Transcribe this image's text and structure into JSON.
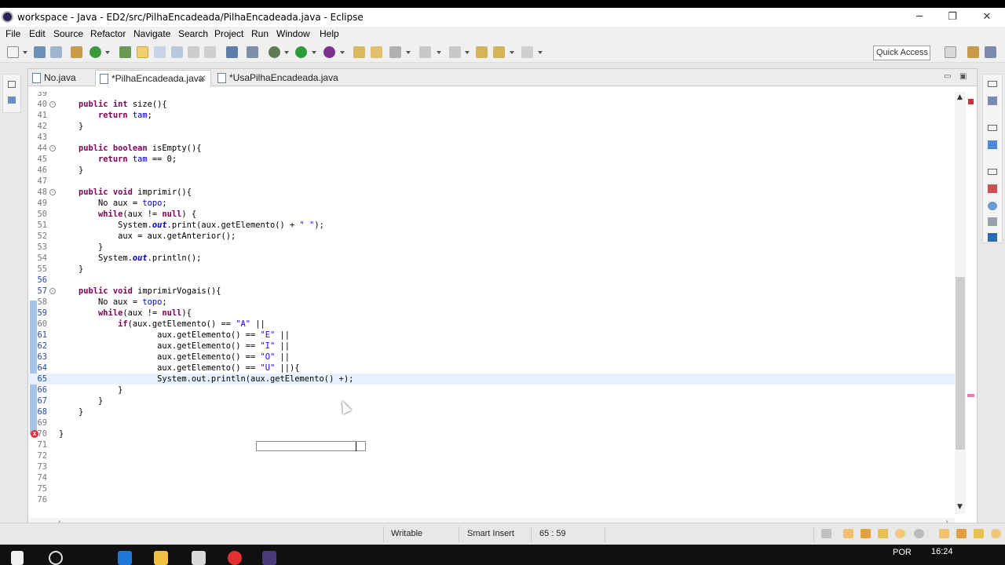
{
  "window": {
    "title": "workspace - Java - ED2/src/PilhaEncadeada/PilhaEncadeada.java - Eclipse",
    "minimize": "─",
    "restore": "❐",
    "close": "✕"
  },
  "menu": [
    "File",
    "Edit",
    "Source",
    "Refactor",
    "Navigate",
    "Search",
    "Project",
    "Run",
    "Window",
    "Help"
  ],
  "toolbar": {
    "quick_access": "Quick Access"
  },
  "tabs": [
    {
      "label": "No.java",
      "active": false
    },
    {
      "label": "*PilhaEncadeada.java",
      "active": true,
      "close": "✕"
    },
    {
      "label": "*UsaPilhaEncadeada.java",
      "active": false
    }
  ],
  "editor": {
    "lines": [
      {
        "n": "39",
        "html": ""
      },
      {
        "n": "40",
        "fold": "⊖",
        "html": "    <span class=\"kw\">public</span> <span class=\"kw\">int</span> size(){"
      },
      {
        "n": "41",
        "html": "        <span class=\"kw\">return</span> <span class=\"fld\">tam</span>;"
      },
      {
        "n": "42",
        "html": "    }"
      },
      {
        "n": "43",
        "html": ""
      },
      {
        "n": "44",
        "fold": "⊖",
        "html": "    <span class=\"kw\">public</span> <span class=\"kw\">boolean</span> isEmpty(){"
      },
      {
        "n": "45",
        "html": "        <span class=\"kw\">return</span> <span class=\"fld\">tam</span> == 0;"
      },
      {
        "n": "46",
        "html": "    }"
      },
      {
        "n": "47",
        "html": ""
      },
      {
        "n": "48",
        "fold": "⊖",
        "html": "    <span class=\"kw\">public</span> <span class=\"kw\">void</span> imprimir(){"
      },
      {
        "n": "49",
        "html": "        No aux = <span class=\"fld\">topo</span>;"
      },
      {
        "n": "50",
        "html": "        <span class=\"kw\">while</span>(aux != <span class=\"kw\">null</span>) {"
      },
      {
        "n": "51",
        "html": "            System.<span class=\"sf\">out</span>.print(aux.getElemento() + <span class=\"str\">\" \"</span>);"
      },
      {
        "n": "52",
        "html": "            aux = aux.getAnterior();"
      },
      {
        "n": "53",
        "html": "        }"
      },
      {
        "n": "54",
        "html": "        System.<span class=\"sf\">out</span>.println();"
      },
      {
        "n": "55",
        "html": "    }"
      },
      {
        "n": "56",
        "changed": true,
        "html": ""
      },
      {
        "n": "57",
        "changed": true,
        "fold": "⊖",
        "html": "    <span class=\"kw\">public</span> <span class=\"kw\">void</span> imprimirVogais(){"
      },
      {
        "n": "58",
        "html": "        No aux = <span class=\"fld\">topo</span>;"
      },
      {
        "n": "59",
        "changed": true,
        "html": "        <span class=\"kw\">while</span>(aux != <span class=\"kw\">null</span>){"
      },
      {
        "n": "60",
        "html": "            <span class=\"kw\">if</span>(aux.getElemento() == <span class=\"str\">\"A\"</span> ||"
      },
      {
        "n": "61",
        "changed": true,
        "html": "                    aux.getElemento() == <span class=\"str\">\"E\"</span> ||"
      },
      {
        "n": "62",
        "changed": true,
        "html": "                    aux.getElemento() == <span class=\"str\">\"I\"</span> ||"
      },
      {
        "n": "63",
        "changed": true,
        "html": "                    aux.getElemento() == <span class=\"str\">\"O\"</span> ||"
      },
      {
        "n": "64",
        "changed": true,
        "error": true,
        "html": "                    aux.getElemento() == <span class=\"str\">\"U\"</span> ||){"
      },
      {
        "n": "65",
        "changed": true,
        "current": true,
        "html": "                    System.out.println(aux.getElemento() +);"
      },
      {
        "n": "66",
        "changed": true,
        "html": "            }"
      },
      {
        "n": "67",
        "changed": true,
        "html": "        }"
      },
      {
        "n": "68",
        "changed": true,
        "html": "    }"
      },
      {
        "n": "69",
        "html": ""
      },
      {
        "n": "70",
        "html": "}"
      },
      {
        "n": "71",
        "html": ""
      },
      {
        "n": "72",
        "html": ""
      },
      {
        "n": "73",
        "html": ""
      },
      {
        "n": "74",
        "html": ""
      },
      {
        "n": "75",
        "html": ""
      },
      {
        "n": "76",
        "html": ""
      }
    ]
  },
  "status": {
    "writable": "Writable",
    "insert_mode": "Smart Insert",
    "position": "65 : 59"
  },
  "taskbar": {
    "language": "POR",
    "time": "16:24"
  },
  "colors": {
    "keyword": "#7f0055",
    "field": "#0000c0",
    "string": "#2a00ff",
    "current_line": "#e8f2fe",
    "error": "#e0303a"
  }
}
